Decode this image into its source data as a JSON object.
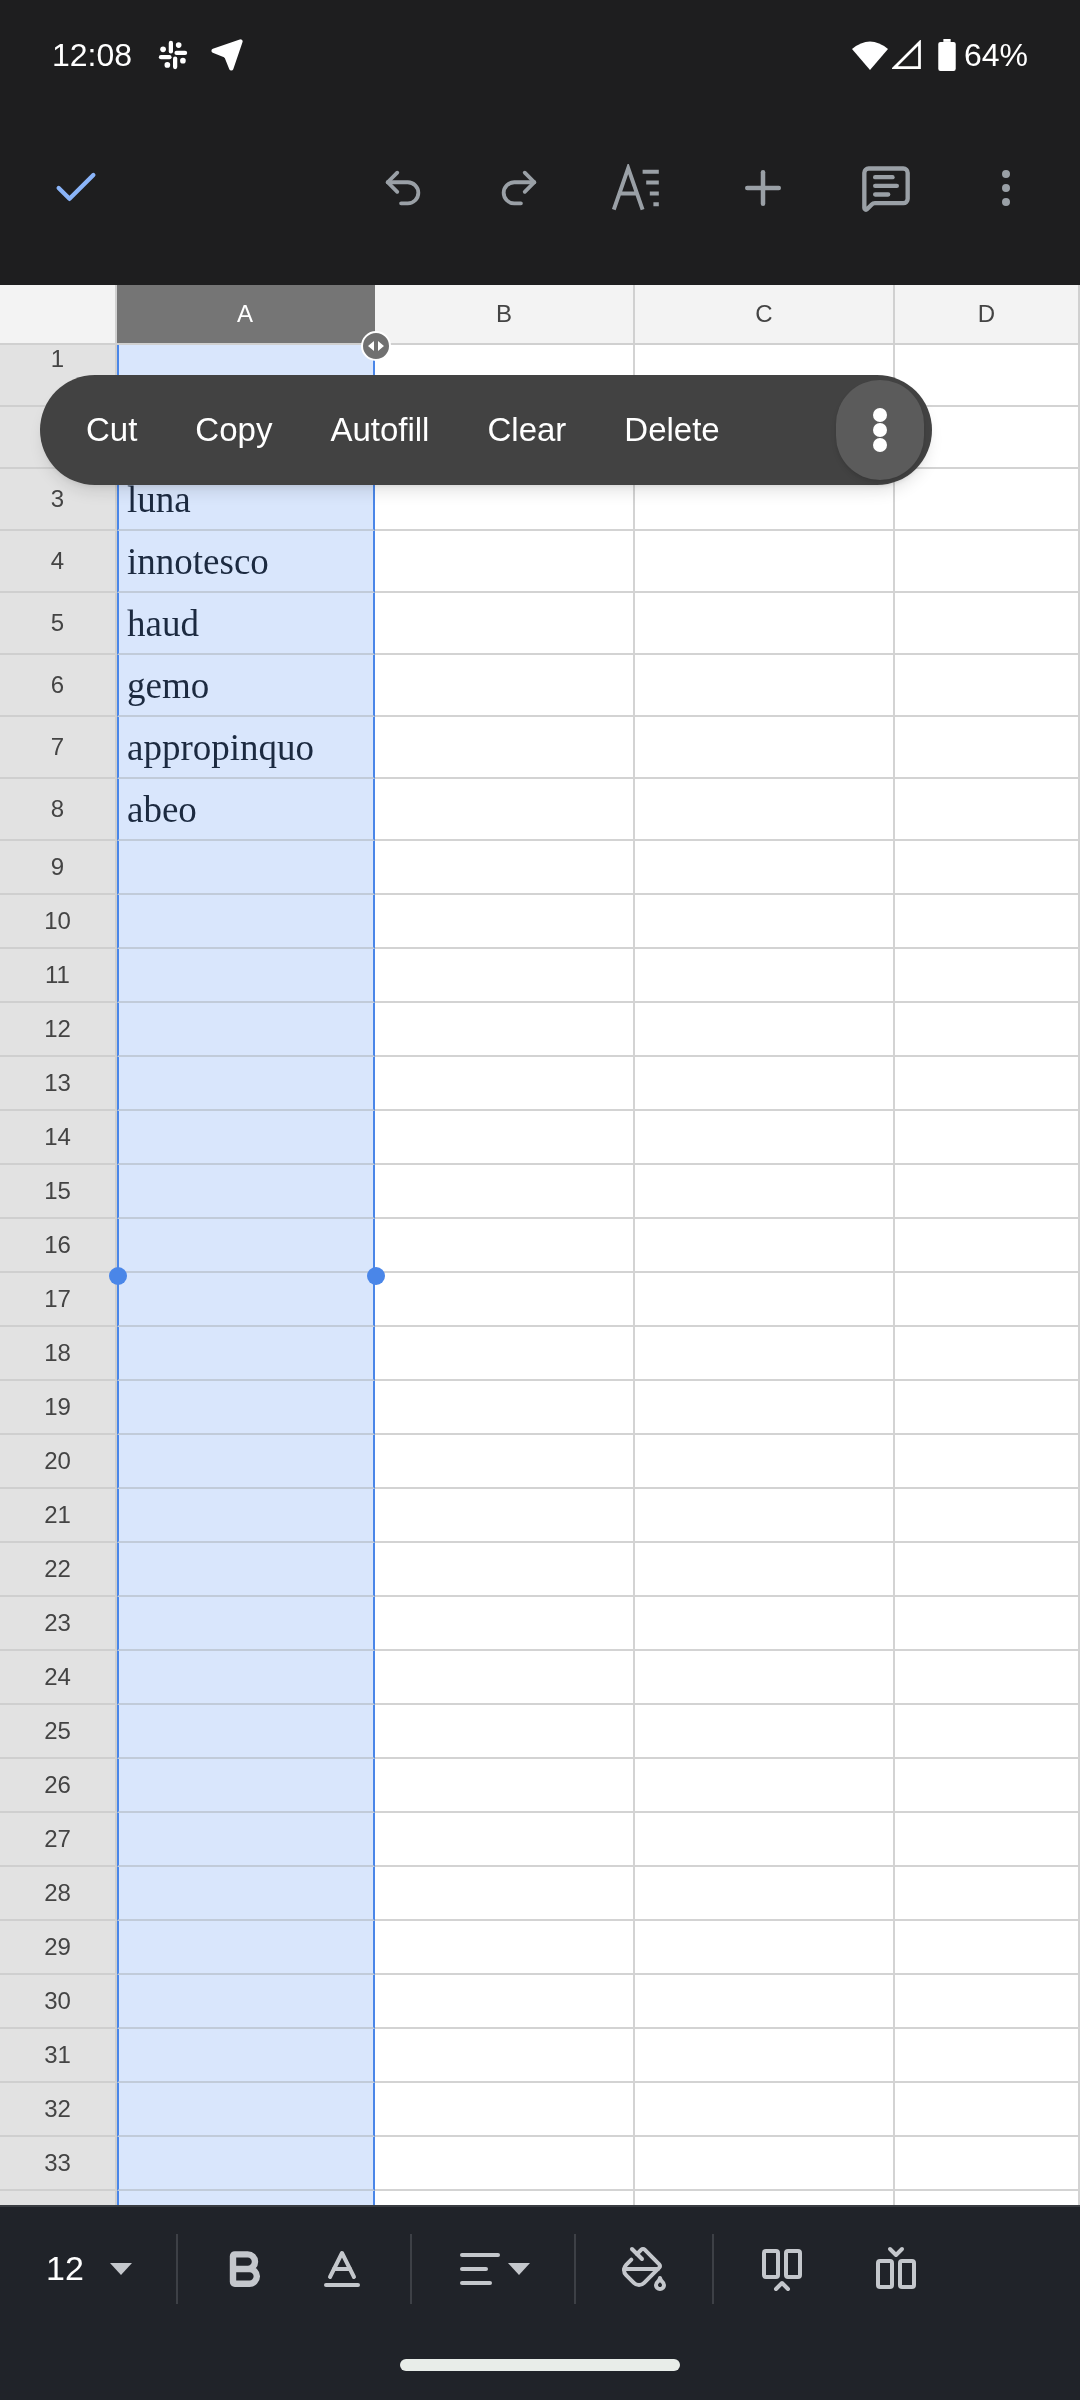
{
  "status_bar": {
    "time": "12:08",
    "battery": "64%"
  },
  "columns": [
    {
      "label": "A",
      "selected": true
    },
    {
      "label": "B",
      "selected": false
    },
    {
      "label": "C",
      "selected": false
    },
    {
      "label": "D",
      "selected": false
    }
  ],
  "rows": [
    {
      "number": "1"
    },
    {},
    {
      "number": "3",
      "value": "luna"
    },
    {
      "number": "4",
      "value": "innotesco"
    },
    {
      "number": "5",
      "value": "haud"
    },
    {
      "number": "6",
      "value": "gemo"
    },
    {
      "number": "7",
      "value": "appropinquo"
    },
    {
      "number": "8",
      "value": "abeo"
    },
    {
      "number": "9"
    },
    {
      "number": "10"
    },
    {
      "number": "11"
    },
    {
      "number": "12"
    },
    {
      "number": "13"
    },
    {
      "number": "14"
    },
    {
      "number": "15"
    },
    {
      "number": "16"
    },
    {
      "number": "17"
    },
    {
      "number": "18"
    },
    {
      "number": "19"
    },
    {
      "number": "20"
    },
    {
      "number": "21"
    },
    {
      "number": "22"
    },
    {
      "number": "23"
    },
    {
      "number": "24"
    },
    {
      "number": "25"
    },
    {
      "number": "26"
    },
    {
      "number": "27"
    },
    {
      "number": "28"
    },
    {
      "number": "29"
    },
    {
      "number": "30"
    },
    {
      "number": "31"
    },
    {
      "number": "32"
    },
    {
      "number": "33"
    }
  ],
  "context_menu": {
    "items": [
      "Cut",
      "Copy",
      "Autofill",
      "Clear",
      "Delete"
    ]
  },
  "format_toolbar": {
    "font_size": "12"
  }
}
